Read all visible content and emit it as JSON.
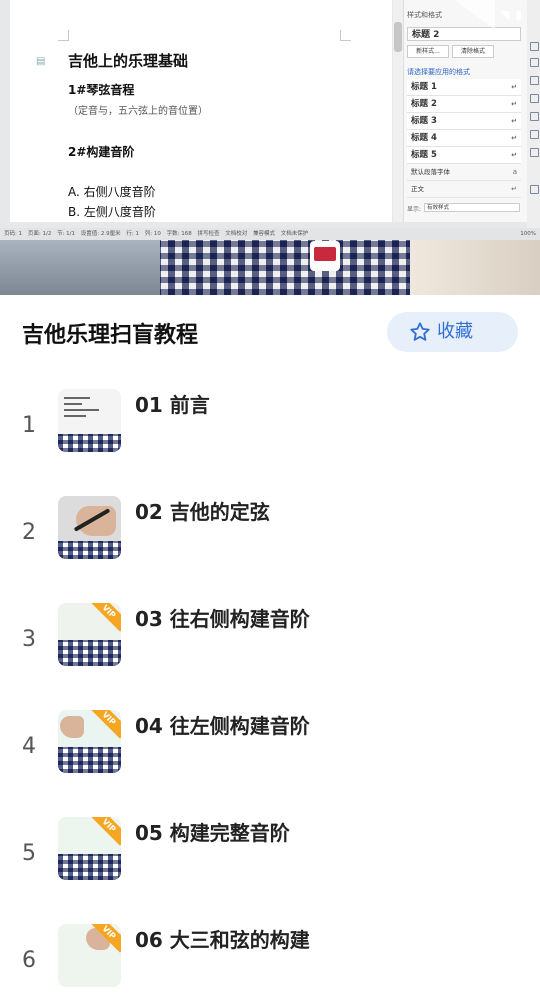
{
  "video": {
    "doc": {
      "title": "吉他上的乐理基础",
      "line1": "1#琴弦音程",
      "line2": "（定音与，五六弦上的音位置）",
      "line3": "2#构建音阶",
      "line4": "A. 右侧八度音阶",
      "line5": "B. 左侧八度音阶"
    },
    "style_panel": {
      "header": "样式和格式",
      "current": "标题 2",
      "btn_new": "新样式...",
      "btn_clear": "清除格式",
      "apply_label": "请选择要应用的格式",
      "items": [
        "标题 1",
        "标题 2",
        "标题 3",
        "标题 4",
        "标题 5"
      ],
      "item_default": "默认段落字体",
      "item_body": "正文",
      "show_label": "显示:",
      "show_value": "有效样式"
    },
    "statusbar": {
      "page": "页码: 1",
      "pages": "页面: 1/2",
      "section": "节: 1/1",
      "setting": "设置值: 2.9厘米",
      "row": "行: 1",
      "col": "列: 10",
      "words": "字数: 168",
      "spell": "拼写检查",
      "proof": "文档校对",
      "compat": "兼容模式",
      "protect": "文档未保护",
      "zoom": "100%"
    }
  },
  "course": {
    "title": "吉他乐理扫盲教程",
    "favorite_label": "收藏"
  },
  "lessons": [
    {
      "num": "1",
      "title": "01 前言",
      "vip": ""
    },
    {
      "num": "2",
      "title": "02 吉他的定弦",
      "vip": ""
    },
    {
      "num": "3",
      "title": "03 往右侧构建音阶",
      "vip": "VIP"
    },
    {
      "num": "4",
      "title": "04 往左侧构建音阶",
      "vip": "VIP"
    },
    {
      "num": "5",
      "title": "05 构建完整音阶",
      "vip": "VIP"
    },
    {
      "num": "6",
      "title": "06 大三和弦的构建",
      "vip": "VIP"
    }
  ],
  "colors": {
    "accent": "#2f6fd6",
    "favorite_bg": "#e7effb",
    "vip": "#f5a623"
  }
}
